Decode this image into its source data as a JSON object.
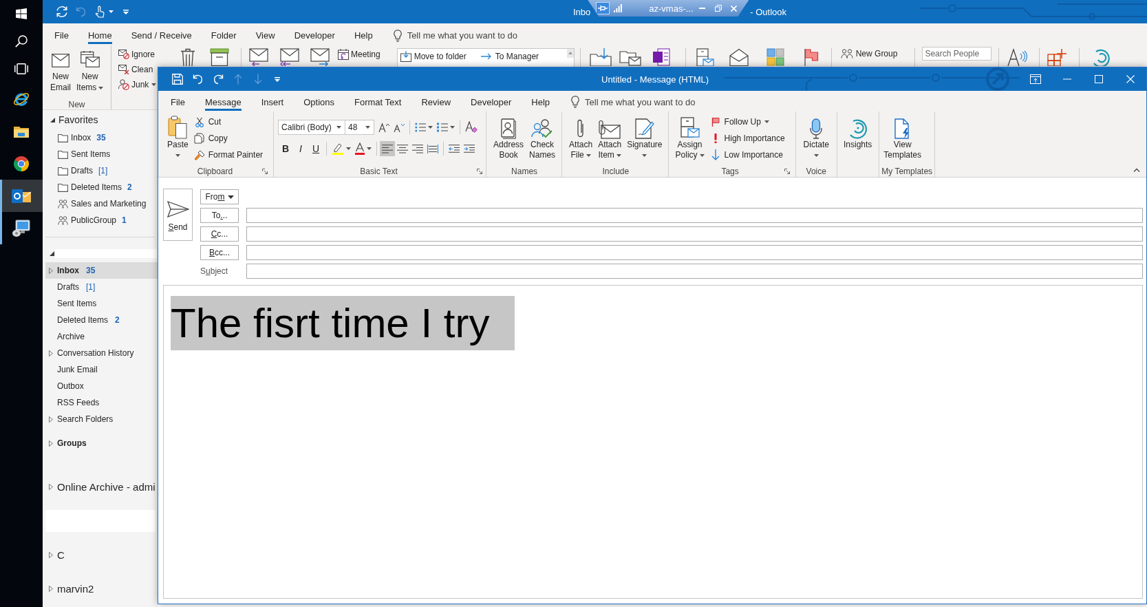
{
  "taskbar": {
    "items": [
      {
        "kind": "start",
        "selected": false,
        "running": false
      },
      {
        "kind": "search",
        "selected": false,
        "running": false
      },
      {
        "kind": "task-view",
        "selected": false,
        "running": false
      },
      {
        "kind": "browser-e",
        "selected": false,
        "running": false
      },
      {
        "kind": "file-folder",
        "selected": false,
        "running": false
      },
      {
        "kind": "browser-ring",
        "selected": false,
        "running": false
      },
      {
        "kind": "mail-app",
        "selected": true,
        "running": true
      },
      {
        "kind": "remote-desktop",
        "selected": false,
        "running": true
      }
    ]
  },
  "main_window": {
    "title_bar": {
      "quick_access": [
        {
          "kind": "sync",
          "disabled": false
        },
        {
          "kind": "undo",
          "disabled": true
        },
        {
          "kind": "touch",
          "disabled": false
        }
      ],
      "title_start": "Inbo",
      "title_end": "- Outlook"
    },
    "remote_bar": {
      "label": "az-vmas-...",
      "pinned": true
    },
    "tabs": [
      {
        "label": "File",
        "selected": false
      },
      {
        "label": "Home",
        "selected": true
      },
      {
        "label": "Send / Receive",
        "selected": false
      },
      {
        "label": "Folder",
        "selected": false
      },
      {
        "label": "View",
        "selected": false
      },
      {
        "label": "Developer",
        "selected": false
      },
      {
        "label": "Help",
        "selected": false
      }
    ],
    "tell_me": "Tell me what you want to do",
    "ribbon": {
      "new_group": {
        "label": "New",
        "buttons": [
          {
            "kind": "new-email",
            "lines": [
              "New",
              "Email"
            ]
          },
          {
            "kind": "new-items",
            "lines": [
              "New",
              "Items"
            ],
            "dropdown": true
          }
        ]
      },
      "respond_items": [
        {
          "kind": "ignore",
          "label": "Ignore"
        },
        {
          "kind": "clean-up",
          "label": "Clean"
        },
        {
          "kind": "junk",
          "label": "Junk",
          "dropdown": true
        }
      ],
      "meeting": {
        "label": "Meeting"
      },
      "quick_steps": [
        {
          "kind": "move-to-folder",
          "label": "Move to folder"
        },
        {
          "kind": "to-manager",
          "label": "To Manager"
        }
      ],
      "new_group_button": {
        "label": "New Group"
      },
      "search_people": {
        "placeholder": "Search People"
      }
    }
  },
  "folder_pane": {
    "favorites": {
      "label": "Favorites",
      "expanded": true,
      "items": [
        {
          "kind": "folder",
          "name": "Inbox",
          "count": "35",
          "unread": true,
          "selected": false
        },
        {
          "kind": "folder",
          "name": "Sent Items",
          "selected": false
        },
        {
          "kind": "folder",
          "name": "Drafts",
          "count": "[1]",
          "unread": false,
          "selected": false
        },
        {
          "kind": "folder",
          "name": "Deleted Items",
          "count": "2",
          "unread": true,
          "selected": false
        },
        {
          "kind": "group",
          "name": "Sales and Marketing",
          "selected": false
        },
        {
          "kind": "group",
          "name": "PublicGroup",
          "count": "1",
          "unread": true,
          "selected": false
        }
      ]
    },
    "mailbox": {
      "expanded": true,
      "redacted": true,
      "folders": [
        {
          "name": "Inbox",
          "count": "35",
          "unread": true,
          "selected": true,
          "expandable": true
        },
        {
          "name": "Drafts",
          "count": "[1]",
          "unread": false,
          "selected": false,
          "expandable": false
        },
        {
          "name": "Sent Items",
          "selected": false,
          "expandable": false
        },
        {
          "name": "Deleted Items",
          "count": "2",
          "unread": true,
          "selected": false,
          "expandable": false
        },
        {
          "name": "Archive",
          "selected": false,
          "expandable": false
        },
        {
          "name": "Conversation History",
          "selected": false,
          "expandable": true
        },
        {
          "name": "Junk Email",
          "selected": false,
          "expandable": false
        },
        {
          "name": "Outbox",
          "selected": false,
          "expandable": false
        },
        {
          "name": "RSS Feeds",
          "selected": false,
          "expandable": false
        },
        {
          "name": "Search Folders",
          "selected": false,
          "expandable": true
        }
      ]
    },
    "groups": {
      "label": "Groups",
      "expandable": true
    },
    "stores": [
      {
        "kind": "store",
        "label": "Online Archive - admi",
        "expandable": true
      },
      {
        "kind": "redacted"
      },
      {
        "kind": "store",
        "label": "C",
        "expandable": true
      },
      {
        "kind": "store",
        "label": "marvin2",
        "expandable": true
      }
    ]
  },
  "message_window": {
    "title_bar": {
      "quick_access": [
        {
          "kind": "save",
          "disabled": false
        },
        {
          "kind": "undo",
          "disabled": false
        },
        {
          "kind": "redo",
          "disabled": false
        },
        {
          "kind": "up",
          "disabled": true
        },
        {
          "kind": "down",
          "disabled": true
        }
      ],
      "title": "Untitled - Message (HTML)"
    },
    "tabs": [
      {
        "label": "File",
        "selected": false
      },
      {
        "label": "Message",
        "selected": true
      },
      {
        "label": "Insert",
        "selected": false
      },
      {
        "label": "Options",
        "selected": false
      },
      {
        "label": "Format Text",
        "selected": false
      },
      {
        "label": "Review",
        "selected": false
      },
      {
        "label": "Developer",
        "selected": false
      },
      {
        "label": "Help",
        "selected": false
      }
    ],
    "tell_me": "Tell me what you want to do",
    "ribbon": {
      "groups": [
        {
          "kind": "clipboard",
          "label": "Clipboard",
          "launcher": true,
          "large": [
            {
              "kind": "paste",
              "lines": [
                "Paste"
              ],
              "dropdown": true
            }
          ],
          "small": [
            {
              "kind": "cut",
              "label": "Cut"
            },
            {
              "kind": "copy",
              "label": "Copy"
            },
            {
              "kind": "format-painter",
              "label": "Format Painter"
            }
          ]
        },
        {
          "kind": "basic-text",
          "label": "Basic Text",
          "launcher": true,
          "font_name": "Calibri (Body)",
          "font_size": "48",
          "formats": [
            {
              "kind": "bold",
              "label": "B",
              "pressed": false
            },
            {
              "kind": "italic",
              "label": "I",
              "pressed": false
            },
            {
              "kind": "underline",
              "label": "U",
              "pressed": false
            }
          ],
          "alignment": [
            {
              "kind": "left",
              "selected": true
            },
            {
              "kind": "center",
              "selected": false
            },
            {
              "kind": "right",
              "selected": false
            },
            {
              "kind": "justify",
              "selected": false
            }
          ]
        },
        {
          "kind": "names",
          "label": "Names",
          "launcher": false,
          "large": [
            {
              "kind": "address-book",
              "lines": [
                "Address",
                "Book"
              ]
            },
            {
              "kind": "check-names",
              "lines": [
                "Check",
                "Names"
              ]
            }
          ]
        },
        {
          "kind": "include",
          "label": "Include",
          "launcher": false,
          "large": [
            {
              "kind": "attach-file",
              "lines": [
                "Attach",
                "File"
              ],
              "dropdown": true
            },
            {
              "kind": "attach-item",
              "lines": [
                "Attach",
                "Item"
              ],
              "dropdown": true
            },
            {
              "kind": "signature",
              "lines": [
                "Signature"
              ],
              "dropdown": true
            }
          ]
        },
        {
          "kind": "tags",
          "label": "Tags",
          "launcher": true,
          "large": [
            {
              "kind": "assign-policy",
              "lines": [
                "Assign",
                "Policy"
              ],
              "dropdown": true
            }
          ],
          "small": [
            {
              "kind": "follow-up",
              "label": "Follow Up",
              "dropdown": true
            },
            {
              "kind": "high-importance",
              "label": "High Importance"
            },
            {
              "kind": "low-importance",
              "label": "Low Importance"
            }
          ]
        },
        {
          "kind": "voice",
          "label": "Voice",
          "launcher": false,
          "large": [
            {
              "kind": "dictate",
              "lines": [
                "Dictate"
              ],
              "dropdown": true
            }
          ]
        },
        {
          "kind": "insights",
          "launcher": false,
          "large": [
            {
              "kind": "insights",
              "lines": [
                "Insights"
              ]
            }
          ]
        },
        {
          "kind": "my-templates",
          "label": "My Templates",
          "launcher": false,
          "large": [
            {
              "kind": "view-templates",
              "lines": [
                "View",
                "Templates"
              ]
            }
          ]
        }
      ]
    },
    "header": {
      "send": {
        "key": "S",
        "rest": "end"
      },
      "from": {
        "pre": "Fro",
        "key": "m",
        "dropdown": true
      },
      "recipients": [
        {
          "pre": "To",
          "key": ".",
          "rest": ".."
        },
        {
          "key": "C",
          "rest": "c..."
        },
        {
          "key": "B",
          "rest": "cc..."
        }
      ],
      "subject": {
        "pre": "S",
        "key": "u",
        "rest": "bject"
      }
    },
    "body": {
      "text": "The fisrt time I try",
      "selected": true
    }
  }
}
